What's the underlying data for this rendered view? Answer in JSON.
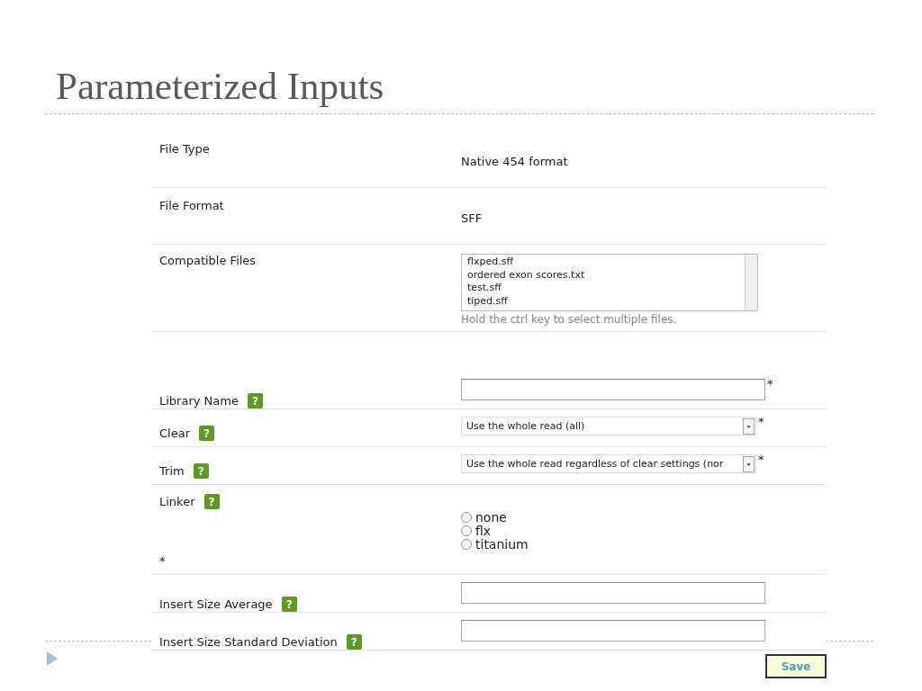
{
  "slide_title": "Parameterized Inputs",
  "form": {
    "rows": [
      {
        "kind": "static",
        "label": "File Type",
        "value": "Native 454 format"
      },
      {
        "kind": "static",
        "label": "File Format",
        "value": "SFF"
      },
      {
        "kind": "listbox",
        "label": "Compatible Files",
        "options": [
          "flxped.sff",
          "ordered exon scores.txt",
          "test.sff",
          "tiped.sff"
        ],
        "hint": "Hold the ctrl key to select multiple files."
      },
      {
        "kind": "spacer"
      },
      {
        "kind": "text",
        "label": "Library Name",
        "help": "?",
        "asterisk": "*",
        "asterisk_under_label": false
      },
      {
        "kind": "select",
        "label": "Clear",
        "help": "?",
        "value": "Use the whole read (all)",
        "asterisk": "*",
        "asterisk_under_label": false
      },
      {
        "kind": "select",
        "label": "Trim",
        "help": "?",
        "value": "Use the whole read regardless of clear settings (nor",
        "asterisk": "*",
        "asterisk_under_label": false
      },
      {
        "kind": "radio",
        "label": "Linker",
        "help": "?",
        "asterisk": "*",
        "asterisk_under_label": true,
        "options": [
          {
            "label": "none",
            "selected": false
          },
          {
            "label": "flx",
            "selected": false
          },
          {
            "label": "titanium",
            "selected": false
          }
        ]
      },
      {
        "kind": "text",
        "label": "Insert Size Average",
        "help": "?"
      },
      {
        "kind": "text",
        "label": "Insert Size Standard Deviation",
        "help": "?"
      }
    ],
    "save_button": "Save"
  }
}
